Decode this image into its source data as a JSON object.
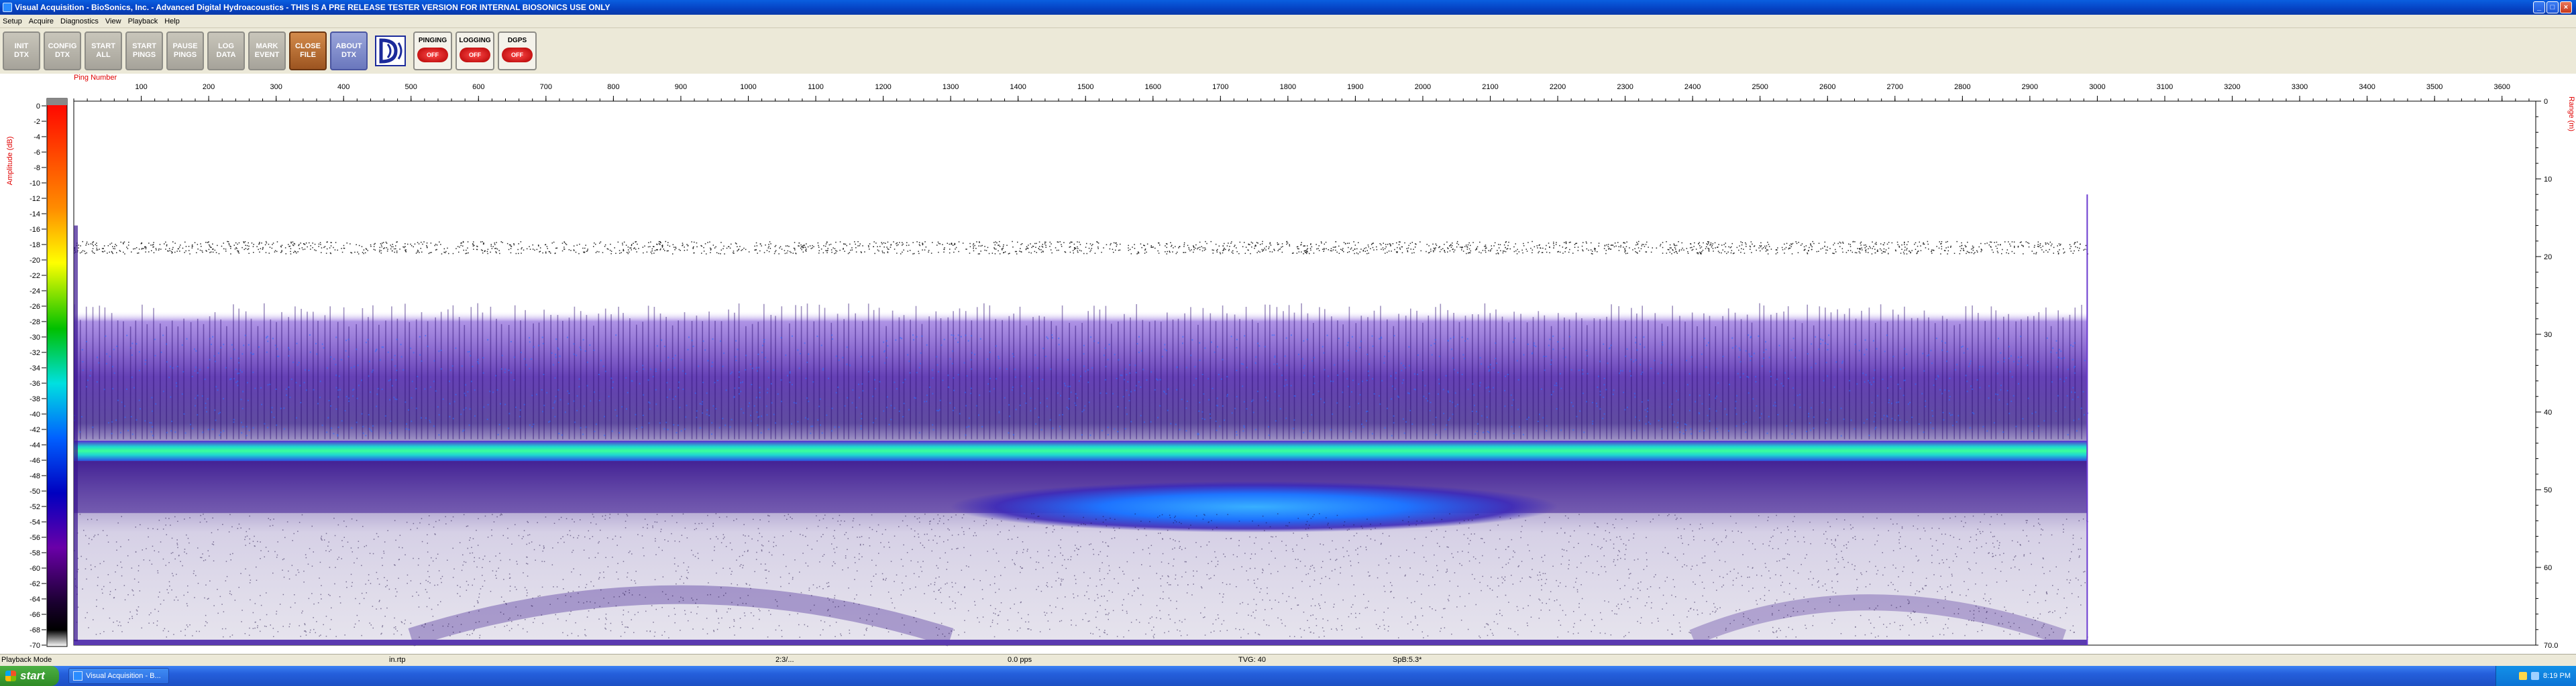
{
  "window": {
    "title": "Visual Acquisition  -  BioSonics, Inc.  -  Advanced Digital Hydroacoustics  -  THIS IS A PRE RELEASE TESTER VERSION FOR INTERNAL BIOSONICS USE ONLY",
    "minimize_glyph": "_",
    "maximize_glyph": "□",
    "close_glyph": "×"
  },
  "menu": [
    "Setup",
    "Acquire",
    "Diagnostics",
    "View",
    "Playback",
    "Help"
  ],
  "toolbar": {
    "buttons": [
      {
        "label": "INIT\nDTX",
        "style": "gray"
      },
      {
        "label": "CONFIG\nDTX",
        "style": "gray"
      },
      {
        "label": "START\nALL",
        "style": "gray"
      },
      {
        "label": "START\nPINGS",
        "style": "gray"
      },
      {
        "label": "PAUSE\nPINGS",
        "style": "gray"
      },
      {
        "label": "LOG\nDATA",
        "style": "gray"
      },
      {
        "label": "MARK\nEVENT",
        "style": "gray"
      },
      {
        "label": "CLOSE\nFILE",
        "style": "close"
      },
      {
        "label": "ABOUT\nDTX",
        "style": "about"
      }
    ],
    "logo_icon": "biosonics-logo-icon",
    "indicators": [
      {
        "label": "PINGING",
        "state": "OFF"
      },
      {
        "label": "LOGGING",
        "state": "OFF"
      },
      {
        "label": "DGPS",
        "state": "OFF"
      }
    ]
  },
  "echogram": {
    "x_axis_title": "Ping Number",
    "x_ticks": [
      100,
      200,
      300,
      400,
      500,
      600,
      700,
      800,
      900,
      1000,
      1100,
      1200,
      1300,
      1400,
      1500,
      1600,
      1700,
      1800,
      1900,
      2000,
      2100,
      2200,
      2300,
      2400,
      2500,
      2600,
      2700,
      2800,
      2900,
      3000,
      3100,
      3200,
      3300,
      3400,
      3500,
      3600
    ],
    "x_max": 3650,
    "last_ping": 2985,
    "y_axis_title": "Range (m)",
    "y_ticks": [
      0,
      10,
      20,
      30,
      40,
      50,
      60
    ],
    "y_max_label": "70.0",
    "y_max": 70,
    "colorbar_title": "Amplitude (dB)",
    "colorbar_ticks": [
      "0",
      "-2",
      "-4",
      "-6",
      "-8",
      "-10",
      "-12",
      "-14",
      "-16",
      "-18",
      "-20",
      "-22",
      "-24",
      "-26",
      "-28",
      "-30",
      "-32",
      "-34",
      "-36",
      "-38",
      "-40",
      "-42",
      "-44",
      "-46",
      "-48",
      "-50",
      "-52",
      "-54",
      "-56",
      "-58",
      "-60",
      "-62",
      "-64",
      "-66",
      "-68",
      "-70"
    ],
    "colors": {
      "axis_title": "#e00000",
      "bottom_echo": "#1fd8d0",
      "school": "#1e74ff",
      "background_echo": "#4a1fa8"
    }
  },
  "status": {
    "mode": "Playback Mode",
    "units": "in.rtp",
    "time": "2:3/...",
    "ping_rate": "0.0 pps",
    "tvg": "TVG: 40",
    "spb": "SpB:5.3*"
  },
  "taskbar": {
    "start_label": "start",
    "task_label": "Visual Acquisition  -  B...",
    "clock": "8:19 PM"
  }
}
